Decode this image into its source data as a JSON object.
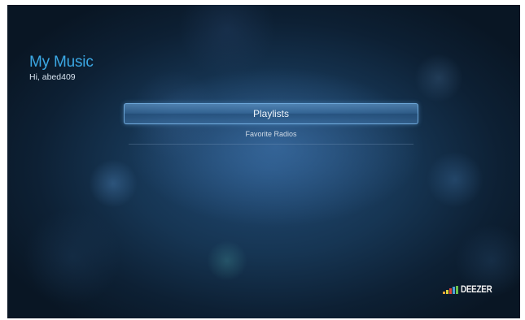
{
  "header": {
    "title": "My Music",
    "greeting": "Hi, abed409"
  },
  "menu": {
    "items": [
      {
        "label": "Playlists",
        "selected": true
      },
      {
        "label": "Favorite Radios",
        "selected": false
      }
    ]
  },
  "brand": {
    "logo_text": "DEEZER",
    "logo_bar_colors": [
      "#e8a33a",
      "#d9d23b",
      "#e0473b",
      "#4fa0d8",
      "#6bc04b"
    ]
  },
  "colors": {
    "title": "#3ba7e3",
    "background": "#163553",
    "selection_border": "#78b4e6"
  }
}
